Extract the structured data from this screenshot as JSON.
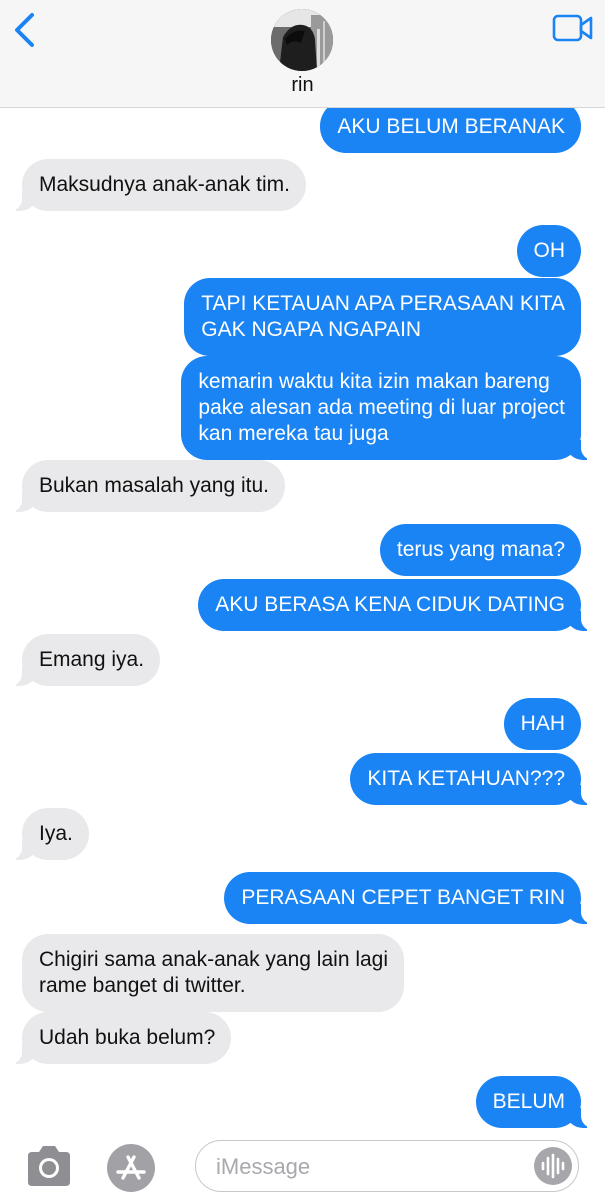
{
  "header": {
    "contact_name": "rin",
    "back_icon": "chevron-left-icon",
    "video_icon": "video-camera-icon",
    "accent": "#1a84f4"
  },
  "messages": [
    {
      "from": "me",
      "text": "AKU BELUM BERANAK"
    },
    {
      "from": "them",
      "text": "Maksudnya anak-anak tim."
    },
    {
      "from": "me",
      "text": "OH"
    },
    {
      "from": "me",
      "text": "TAPI KETAUAN APA PERASAAN KITA\nGAK NGAPA NGAPAIN"
    },
    {
      "from": "me",
      "text": "kemarin waktu kita izin makan bareng\npake alesan ada meeting di luar project\nkan mereka tau juga"
    },
    {
      "from": "them",
      "text": "Bukan masalah yang itu."
    },
    {
      "from": "me",
      "text": "terus yang mana?"
    },
    {
      "from": "me",
      "text": "AKU BERASA KENA CIDUK DATING"
    },
    {
      "from": "them",
      "text": "Emang iya."
    },
    {
      "from": "me",
      "text": "HAH"
    },
    {
      "from": "me",
      "text": "KITA KETAHUAN???"
    },
    {
      "from": "them",
      "text": "Iya."
    },
    {
      "from": "me",
      "text": "PERASAAN CEPET BANGET RIN"
    },
    {
      "from": "them",
      "text": "Chigiri sama anak-anak yang lain lagi\nrame banget di twitter."
    },
    {
      "from": "them",
      "text": "Udah buka belum?"
    },
    {
      "from": "me",
      "text": "BELUM"
    }
  ],
  "composer": {
    "placeholder": "iMessage",
    "value": "",
    "camera_icon": "camera-icon",
    "apps_icon": "app-store-icon",
    "audio_icon": "audio-waveform-icon"
  },
  "colors": {
    "outgoing_bubble": "#1a84f4",
    "incoming_bubble": "#e9e9eb",
    "header_bg": "#f6f6f7"
  }
}
